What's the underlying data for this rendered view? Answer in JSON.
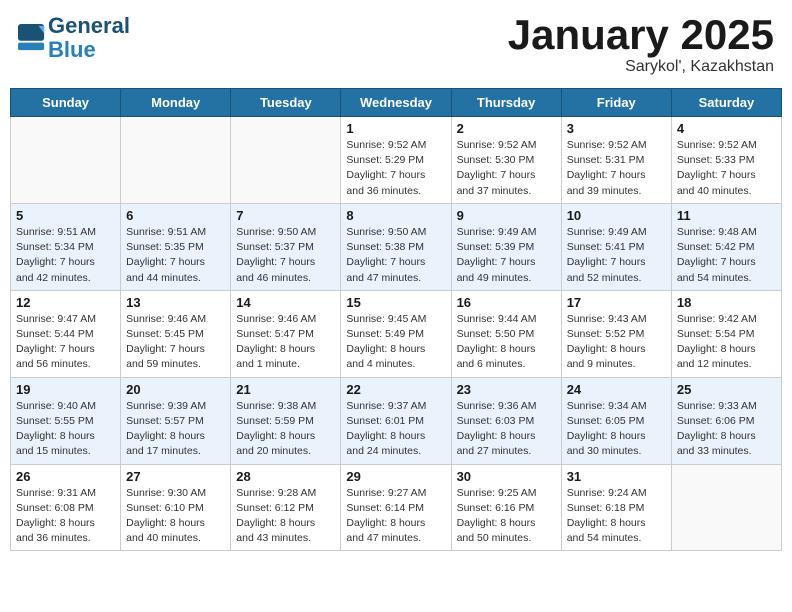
{
  "header": {
    "logo_line1": "General",
    "logo_line2": "Blue",
    "month_title": "January 2025",
    "subtitle": "Sarykol', Kazakhstan"
  },
  "days_of_week": [
    "Sunday",
    "Monday",
    "Tuesday",
    "Wednesday",
    "Thursday",
    "Friday",
    "Saturday"
  ],
  "weeks": [
    {
      "alt": false,
      "days": [
        {
          "num": "",
          "info": ""
        },
        {
          "num": "",
          "info": ""
        },
        {
          "num": "",
          "info": ""
        },
        {
          "num": "1",
          "info": "Sunrise: 9:52 AM\nSunset: 5:29 PM\nDaylight: 7 hours\nand 36 minutes."
        },
        {
          "num": "2",
          "info": "Sunrise: 9:52 AM\nSunset: 5:30 PM\nDaylight: 7 hours\nand 37 minutes."
        },
        {
          "num": "3",
          "info": "Sunrise: 9:52 AM\nSunset: 5:31 PM\nDaylight: 7 hours\nand 39 minutes."
        },
        {
          "num": "4",
          "info": "Sunrise: 9:52 AM\nSunset: 5:33 PM\nDaylight: 7 hours\nand 40 minutes."
        }
      ]
    },
    {
      "alt": true,
      "days": [
        {
          "num": "5",
          "info": "Sunrise: 9:51 AM\nSunset: 5:34 PM\nDaylight: 7 hours\nand 42 minutes."
        },
        {
          "num": "6",
          "info": "Sunrise: 9:51 AM\nSunset: 5:35 PM\nDaylight: 7 hours\nand 44 minutes."
        },
        {
          "num": "7",
          "info": "Sunrise: 9:50 AM\nSunset: 5:37 PM\nDaylight: 7 hours\nand 46 minutes."
        },
        {
          "num": "8",
          "info": "Sunrise: 9:50 AM\nSunset: 5:38 PM\nDaylight: 7 hours\nand 47 minutes."
        },
        {
          "num": "9",
          "info": "Sunrise: 9:49 AM\nSunset: 5:39 PM\nDaylight: 7 hours\nand 49 minutes."
        },
        {
          "num": "10",
          "info": "Sunrise: 9:49 AM\nSunset: 5:41 PM\nDaylight: 7 hours\nand 52 minutes."
        },
        {
          "num": "11",
          "info": "Sunrise: 9:48 AM\nSunset: 5:42 PM\nDaylight: 7 hours\nand 54 minutes."
        }
      ]
    },
    {
      "alt": false,
      "days": [
        {
          "num": "12",
          "info": "Sunrise: 9:47 AM\nSunset: 5:44 PM\nDaylight: 7 hours\nand 56 minutes."
        },
        {
          "num": "13",
          "info": "Sunrise: 9:46 AM\nSunset: 5:45 PM\nDaylight: 7 hours\nand 59 minutes."
        },
        {
          "num": "14",
          "info": "Sunrise: 9:46 AM\nSunset: 5:47 PM\nDaylight: 8 hours\nand 1 minute."
        },
        {
          "num": "15",
          "info": "Sunrise: 9:45 AM\nSunset: 5:49 PM\nDaylight: 8 hours\nand 4 minutes."
        },
        {
          "num": "16",
          "info": "Sunrise: 9:44 AM\nSunset: 5:50 PM\nDaylight: 8 hours\nand 6 minutes."
        },
        {
          "num": "17",
          "info": "Sunrise: 9:43 AM\nSunset: 5:52 PM\nDaylight: 8 hours\nand 9 minutes."
        },
        {
          "num": "18",
          "info": "Sunrise: 9:42 AM\nSunset: 5:54 PM\nDaylight: 8 hours\nand 12 minutes."
        }
      ]
    },
    {
      "alt": true,
      "days": [
        {
          "num": "19",
          "info": "Sunrise: 9:40 AM\nSunset: 5:55 PM\nDaylight: 8 hours\nand 15 minutes."
        },
        {
          "num": "20",
          "info": "Sunrise: 9:39 AM\nSunset: 5:57 PM\nDaylight: 8 hours\nand 17 minutes."
        },
        {
          "num": "21",
          "info": "Sunrise: 9:38 AM\nSunset: 5:59 PM\nDaylight: 8 hours\nand 20 minutes."
        },
        {
          "num": "22",
          "info": "Sunrise: 9:37 AM\nSunset: 6:01 PM\nDaylight: 8 hours\nand 24 minutes."
        },
        {
          "num": "23",
          "info": "Sunrise: 9:36 AM\nSunset: 6:03 PM\nDaylight: 8 hours\nand 27 minutes."
        },
        {
          "num": "24",
          "info": "Sunrise: 9:34 AM\nSunset: 6:05 PM\nDaylight: 8 hours\nand 30 minutes."
        },
        {
          "num": "25",
          "info": "Sunrise: 9:33 AM\nSunset: 6:06 PM\nDaylight: 8 hours\nand 33 minutes."
        }
      ]
    },
    {
      "alt": false,
      "days": [
        {
          "num": "26",
          "info": "Sunrise: 9:31 AM\nSunset: 6:08 PM\nDaylight: 8 hours\nand 36 minutes."
        },
        {
          "num": "27",
          "info": "Sunrise: 9:30 AM\nSunset: 6:10 PM\nDaylight: 8 hours\nand 40 minutes."
        },
        {
          "num": "28",
          "info": "Sunrise: 9:28 AM\nSunset: 6:12 PM\nDaylight: 8 hours\nand 43 minutes."
        },
        {
          "num": "29",
          "info": "Sunrise: 9:27 AM\nSunset: 6:14 PM\nDaylight: 8 hours\nand 47 minutes."
        },
        {
          "num": "30",
          "info": "Sunrise: 9:25 AM\nSunset: 6:16 PM\nDaylight: 8 hours\nand 50 minutes."
        },
        {
          "num": "31",
          "info": "Sunrise: 9:24 AM\nSunset: 6:18 PM\nDaylight: 8 hours\nand 54 minutes."
        },
        {
          "num": "",
          "info": ""
        }
      ]
    }
  ]
}
